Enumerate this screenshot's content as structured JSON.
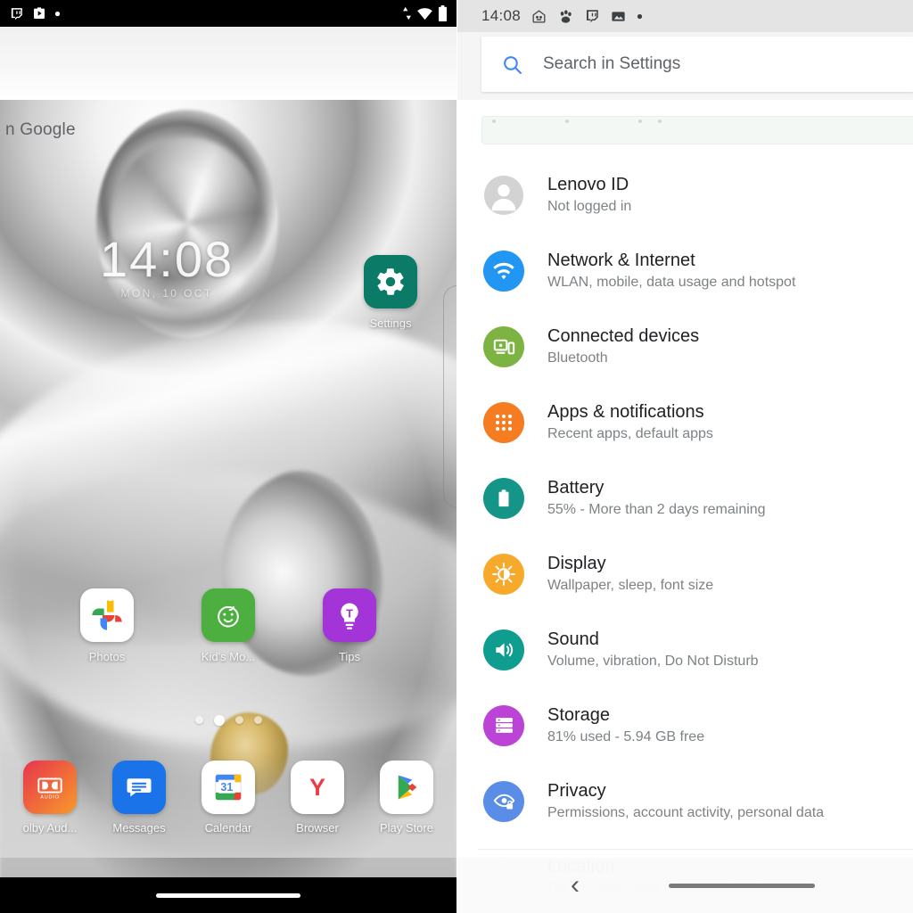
{
  "left_panel": {
    "status_bar": {
      "icons": [
        "twitch-icon",
        "media-play-icon",
        "dot-icon"
      ],
      "right_icons": [
        "data-transfer-icon",
        "wifi-icon",
        "battery-icon"
      ]
    },
    "google_widget_label": "n Google",
    "clock": {
      "time": "14:08",
      "date": "MON, 10 OCT"
    },
    "settings_shortcut": {
      "label": "Settings",
      "color": "#0b7a66"
    },
    "apps": [
      {
        "label": "Photos",
        "icon": "google-photos-icon"
      },
      {
        "label": "Kid's Mo...",
        "icon": "kids-mode-icon",
        "color": "#4caf3f"
      },
      {
        "label": "Tips",
        "icon": "tips-bulb-icon",
        "color": "#a335d8"
      }
    ],
    "page_dots": {
      "count": 4,
      "active_index": 1
    },
    "dock": [
      {
        "label": "olby Aud...",
        "icon": "dolby-audio-icon"
      },
      {
        "label": "Messages",
        "icon": "messages-icon",
        "color": "#1a73e8"
      },
      {
        "label": "Calendar",
        "icon": "google-calendar-icon",
        "day": "31"
      },
      {
        "label": "Browser",
        "icon": "yandex-browser-icon",
        "color": "#ee3a43"
      },
      {
        "label": "Play Store",
        "icon": "google-play-icon"
      }
    ],
    "nav_bar": {
      "gesture_pill": "home-gesture-pill"
    }
  },
  "right_panel": {
    "status_bar": {
      "time": "14:08",
      "icons": [
        "house-notification-icon",
        "paw-print-icon",
        "twitch-icon",
        "image-icon",
        "dot-icon"
      ]
    },
    "search": {
      "placeholder": "Search in Settings",
      "value": "",
      "icon": "search-icon",
      "icon_color": "#4285f4"
    },
    "settings_items": [
      {
        "title": "Lenovo ID",
        "subtitle": "Not logged in",
        "icon": "account-avatar-icon",
        "color": "#c9c9c9"
      },
      {
        "title": "Network & Internet",
        "subtitle": "WLAN, mobile, data usage and hotspot",
        "icon": "wifi-icon",
        "color": "#2196f3"
      },
      {
        "title": "Connected devices",
        "subtitle": "Bluetooth",
        "icon": "cast-devices-icon",
        "color": "#7cb342"
      },
      {
        "title": "Apps & notifications",
        "subtitle": "Recent apps, default apps",
        "icon": "apps-grid-icon",
        "color": "#f57c20"
      },
      {
        "title": "Battery",
        "subtitle": "55% - More than 2 days remaining",
        "icon": "battery-icon",
        "color": "#159588"
      },
      {
        "title": "Display",
        "subtitle": "Wallpaper, sleep, font size",
        "icon": "brightness-icon",
        "color": "#f7a92b"
      },
      {
        "title": "Sound",
        "subtitle": "Volume, vibration, Do Not Disturb",
        "icon": "volume-icon",
        "color": "#0f9d8f"
      },
      {
        "title": "Storage",
        "subtitle": "81% used - 5.94 GB free",
        "icon": "storage-icon",
        "color": "#bb43d6"
      },
      {
        "title": "Privacy",
        "subtitle": "Permissions, account activity, personal data",
        "icon": "privacy-eye-icon",
        "color": "#5a8de8"
      },
      {
        "title": "Location",
        "subtitle": "On – 5 apps have access to location",
        "icon": "location-pin-icon",
        "color": "#cfe9e4"
      }
    ],
    "nav_bar": {
      "back_label": "‹",
      "gesture_pill": "home-gesture-pill"
    }
  }
}
